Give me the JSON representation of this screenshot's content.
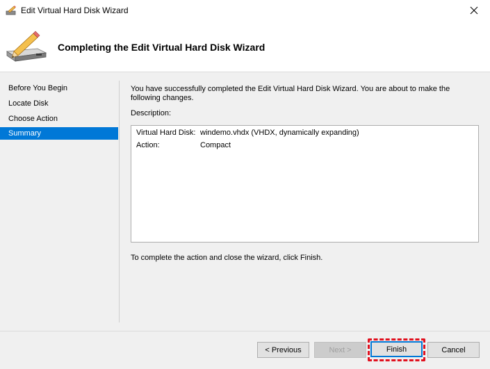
{
  "window": {
    "title": "Edit Virtual Hard Disk Wizard",
    "close_label": "×"
  },
  "header": {
    "heading": "Completing the Edit Virtual Hard Disk Wizard"
  },
  "nav": {
    "items": [
      {
        "label": "Before You Begin",
        "selected": false
      },
      {
        "label": "Locate Disk",
        "selected": false
      },
      {
        "label": "Choose Action",
        "selected": false
      },
      {
        "label": "Summary",
        "selected": true
      }
    ]
  },
  "content": {
    "intro": "You have successfully completed the Edit Virtual Hard Disk Wizard. You are about to make the following changes.",
    "description_label": "Description:",
    "summary_rows": [
      {
        "key": "Virtual Hard Disk:",
        "value": "windemo.vhdx (VHDX, dynamically expanding)"
      },
      {
        "key": "Action:",
        "value": "Compact"
      }
    ],
    "finish_note": "To complete the action and close the wizard, click Finish."
  },
  "buttons": {
    "previous": "< Previous",
    "next": "Next >",
    "finish": "Finish",
    "cancel": "Cancel"
  },
  "colors": {
    "selection": "#0078d7",
    "highlight": "#e0101e"
  }
}
